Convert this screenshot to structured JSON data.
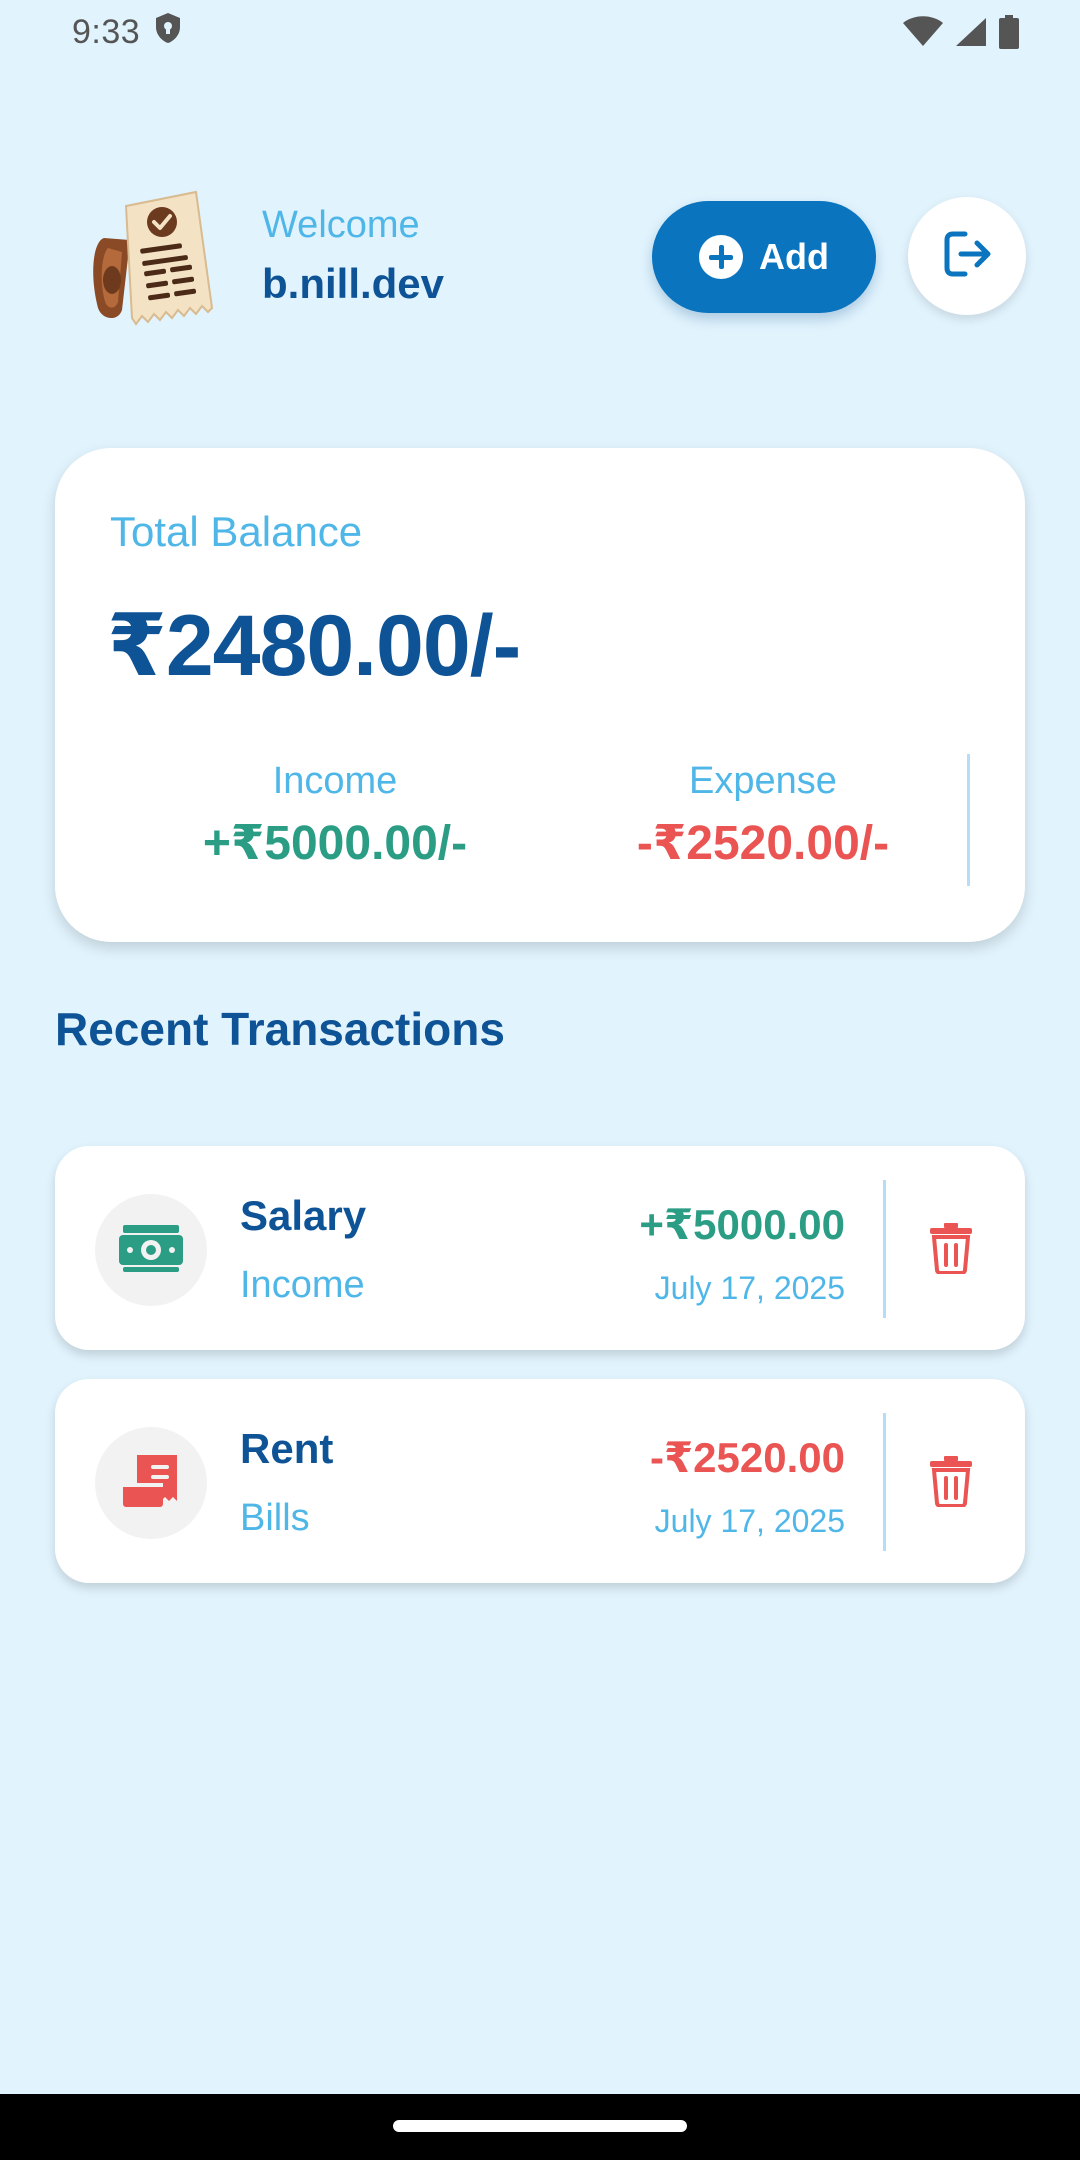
{
  "status_bar": {
    "time": "9:33",
    "icons": [
      "shield-icon",
      "wifi-icon",
      "cell-signal-icon",
      "battery-icon"
    ]
  },
  "header": {
    "logo_icon": "receipt-scroll-icon",
    "welcome_label": "Welcome",
    "user_name": "b.nill.dev",
    "add_button_label": "Add",
    "add_icon": "plus-circle-icon",
    "logout_icon": "logout-icon"
  },
  "balance_card": {
    "label": "Total Balance",
    "amount": "₹2480.00/-",
    "income": {
      "label": "Income",
      "value": "+₹5000.00/-"
    },
    "expense": {
      "label": "Expense",
      "value": "-₹2520.00/-"
    }
  },
  "recent": {
    "title": "Recent Transactions",
    "transactions": [
      {
        "title": "Salary",
        "category": "Income",
        "amount": "+₹5000.00",
        "date": "July 17, 2025",
        "icon": "money-icon",
        "type": "income"
      },
      {
        "title": "Rent",
        "category": "Bills",
        "amount": "-₹2520.00",
        "date": "July 17, 2025",
        "icon": "bill-receipt-icon",
        "type": "expense"
      }
    ]
  },
  "colors": {
    "background": "#e1f3fd",
    "primary": "#0a74bf",
    "heading": "#0e5396",
    "label": "#4fb6e8",
    "income": "#2a9d84",
    "expense": "#ea5452"
  }
}
